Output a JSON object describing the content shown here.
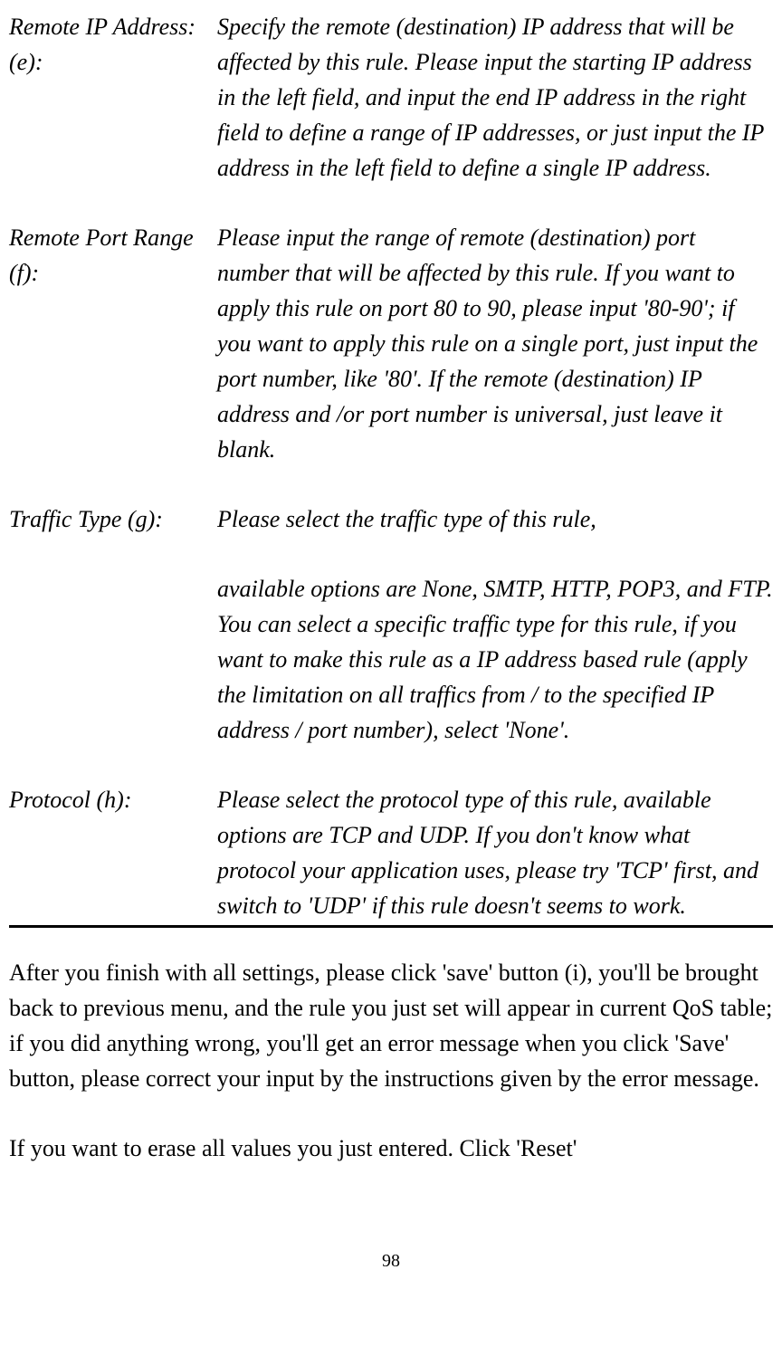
{
  "definitions": {
    "remoteIp": {
      "term": "Remote IP Address: (e):",
      "desc": "Specify the remote (destination) IP address that will be affected by this rule. Please input the starting IP address in the left field, and input the end IP address in the right field to define a range of IP addresses, or just input the IP address in the left field to define a single IP address."
    },
    "remotePort": {
      "term": "Remote Port Range (f):",
      "desc": "Please input the range of remote (destination) port number that will be affected by this rule. If you want to apply this rule on port 80 to 90, please input '80-90'; if you want to apply this rule on a single port, just input the port number, like '80'. If the remote (destination) IP address and /or port number is universal, just leave it blank."
    },
    "trafficType": {
      "term": "Traffic Type (g):",
      "desc1": "Please select the traffic type of this rule,",
      "desc2": "available options are None, SMTP, HTTP, POP3, and FTP. You can select a specific traffic type for this rule, if you want to make this rule as a IP address based rule (apply the limitation on all traffics from / to the specified IP address / port number), select 'None'."
    },
    "protocol": {
      "term": "Protocol (h):",
      "desc": "Please select the protocol type of this rule, available options are TCP and UDP. If you don't know what protocol your application uses, please try 'TCP' first, and switch to 'UDP' if this rule doesn't seems to work."
    }
  },
  "body": {
    "p1": "After you finish with all settings, please click 'save' button (i), you'll be brought back to previous menu, and the rule you just set will appear in current QoS table; if you did anything wrong, you'll get an error message when you click 'Save' button, please correct your input by the instructions given by the error message.",
    "p2": "If you want to erase all values you just entered. Click 'Reset'"
  },
  "pageNumber": "98"
}
